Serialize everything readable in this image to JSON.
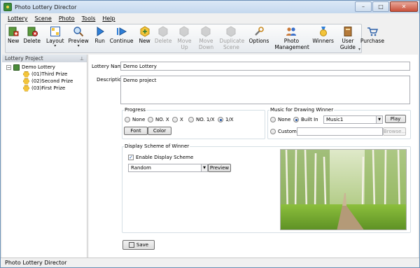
{
  "window": {
    "title": "Photo Lottery Director"
  },
  "menu": [
    "Lottery",
    "Scene",
    "Photo",
    "Tools",
    "Help"
  ],
  "toolbar": {
    "new": "New",
    "delete": "Delete",
    "layout": "Layout",
    "preview": "Preview",
    "run": "Run",
    "continue": "Continue",
    "new2": "New",
    "delete2": "Delete",
    "move_up": "Move Up",
    "move_down": "Move Down",
    "duplicate_scene": "Duplicate Scene",
    "options": "Options",
    "photo_management": "Photo Management",
    "winners": "Winners",
    "user_guide": "User Guide",
    "purchase": "Purchase"
  },
  "left_panel": {
    "header": "Lottery Project",
    "root": "Demo Lottery",
    "children": [
      "(01)Third Prize",
      "(02)Second Prize",
      "(03)First Prize"
    ]
  },
  "form": {
    "lottery_name_label": "Lottery Name",
    "lottery_name_value": "Demo Lottery",
    "description_label": "Description",
    "description_value": "Demo project",
    "progress": {
      "title": "Progress",
      "options": [
        "None",
        "NO. X",
        "X",
        "NO. 1/X",
        "1/X"
      ],
      "selected": "1/X",
      "font_button": "Font",
      "color_button": "Color"
    },
    "music": {
      "title": "Music for Drawing Winner",
      "options": [
        "None",
        "Built In",
        "Custom"
      ],
      "selected": "Built In",
      "builtin_value": "Music1",
      "play_button": "Play",
      "browse_button": "Browse..."
    },
    "display": {
      "title": "Display Scheme of Winner",
      "enable_label": "Enable Display Scheme",
      "enabled": true,
      "scheme_value": "Random",
      "preview_button": "Preview"
    },
    "save_button": "Save"
  },
  "status": {
    "text": "Photo Lottery Director"
  },
  "colors": {
    "window_border": "#6a8fb5",
    "accent": "#1a4fa0",
    "toolbar_bg": "#e7ebef"
  }
}
